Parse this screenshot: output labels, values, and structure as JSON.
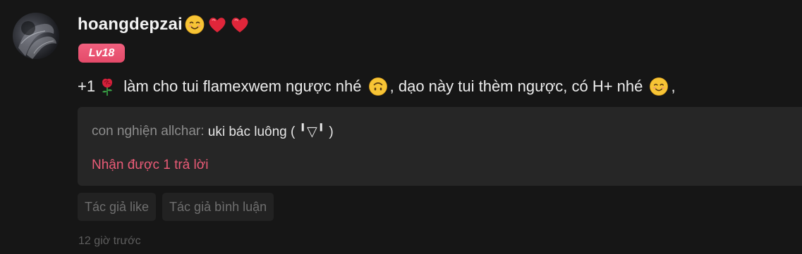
{
  "user": {
    "username": "hoangdepzai",
    "name_emojis": [
      "smiling-face-emoji",
      "red-heart-emoji",
      "red-heart-emoji"
    ],
    "level": "Lv18",
    "level_color": "#e8506f"
  },
  "comment": {
    "segments": [
      {
        "text": "+1"
      },
      {
        "icon": "rose-emoji"
      },
      {
        "text": " làm cho tui flamexwem ngược nhé "
      },
      {
        "icon": "upside-down-face-emoji"
      },
      {
        "text": ", dạo này tui thèm ngược, có H+ nhé "
      },
      {
        "icon": "smiling-face-emoji"
      },
      {
        "text": ","
      }
    ]
  },
  "reply": {
    "author": "con nghiện allchar",
    "separator": ": ",
    "content": "uki bác luông ( ╹▽╹ )",
    "count_label": "Nhận được 1 trả lời",
    "accent_color": "#ea5b77"
  },
  "tags": [
    {
      "label": "Tác giả like"
    },
    {
      "label": "Tác giả bình luận"
    }
  ],
  "timestamp": "12 giờ trước"
}
